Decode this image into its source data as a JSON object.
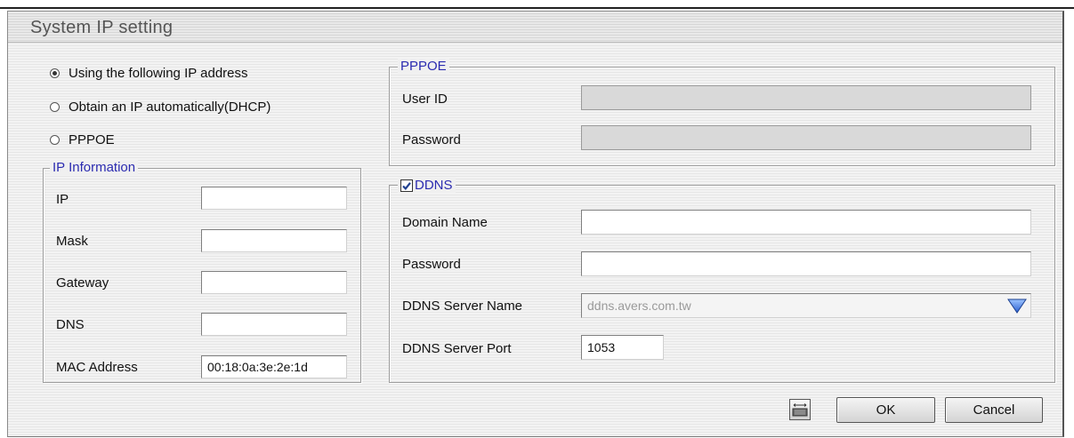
{
  "window": {
    "title": "System IP setting"
  },
  "network_mode": {
    "options": [
      {
        "label": "Using the following IP address",
        "selected": true
      },
      {
        "label": "Obtain an IP automatically(DHCP)",
        "selected": false
      },
      {
        "label": "PPPOE",
        "selected": false
      }
    ]
  },
  "ip_info": {
    "legend": "IP Information",
    "ip": {
      "label": "IP",
      "value": ""
    },
    "mask": {
      "label": "Mask",
      "value": ""
    },
    "gateway": {
      "label": "Gateway",
      "value": ""
    },
    "dns": {
      "label": "DNS",
      "value": ""
    },
    "mac": {
      "label": "MAC Address",
      "value": "00:18:0a:3e:2e:1d"
    }
  },
  "pppoe": {
    "legend": "PPPOE",
    "user_id": {
      "label": "User ID",
      "value": ""
    },
    "password": {
      "label": "Password",
      "value": ""
    }
  },
  "ddns": {
    "legend": "DDNS",
    "enabled": true,
    "domain_name": {
      "label": "Domain Name",
      "value": ""
    },
    "password": {
      "label": "Password",
      "value": ""
    },
    "server_name": {
      "label": "DDNS Server Name",
      "value": "ddns.avers.com.tw"
    },
    "server_port": {
      "label": "DDNS Server Port",
      "value": "1053"
    }
  },
  "footer": {
    "keyboard_icon": "keyboard-icon",
    "ok_label": "OK",
    "cancel_label": "Cancel"
  },
  "colors": {
    "legend_text": "#2b2bb0",
    "dropdown_arrow": "#3a6fd8"
  }
}
